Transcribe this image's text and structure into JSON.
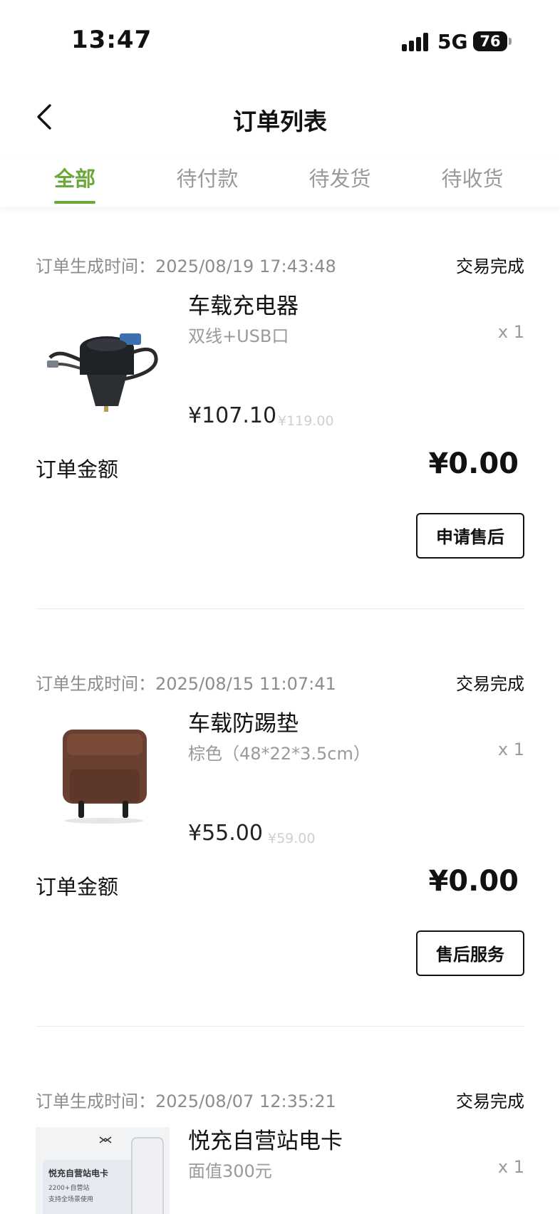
{
  "status_bar": {
    "time": "13:47",
    "network": "5G",
    "battery": "76"
  },
  "nav": {
    "title": "订单列表"
  },
  "tabs": [
    {
      "label": "全部",
      "active": true
    },
    {
      "label": "待付款"
    },
    {
      "label": "待发货"
    },
    {
      "label": "待收货"
    }
  ],
  "colors": {
    "accent": "#6aa837",
    "muted": "#9a9a9a"
  },
  "orders": [
    {
      "time_label": "订单生成时间：2025/08/19 17:43:48",
      "status": "交易完成",
      "product_name": "车载充电器",
      "spec": "双线+USB口",
      "qty": "x 1",
      "price": "¥107.10",
      "original_price": "¥119.00",
      "amount_label": "订单金额",
      "amount": "¥0.00",
      "action": "申请售后",
      "image_icon": "car-charger-image"
    },
    {
      "time_label": "订单生成时间：2025/08/15 11:07:41",
      "status": "交易完成",
      "product_name": "车载防踢垫",
      "spec": "棕色（48*22*3.5cm）",
      "qty": "x 1",
      "price": "¥55.00",
      "original_price": "¥59.00",
      "amount_label": "订单金额",
      "amount": "¥0.00",
      "action": "售后服务",
      "image_icon": "kick-mat-image"
    },
    {
      "time_label": "订单生成时间：2025/08/07 12:35:21",
      "status": "交易完成",
      "product_name": "悦充自营站电卡",
      "spec": "面值300元",
      "qty": "x 1",
      "image_icon": "charge-card-image",
      "card_text": "悦充自营站电卡",
      "card_line1": "2200+自营站",
      "card_line2": "支持全场景使用"
    }
  ]
}
